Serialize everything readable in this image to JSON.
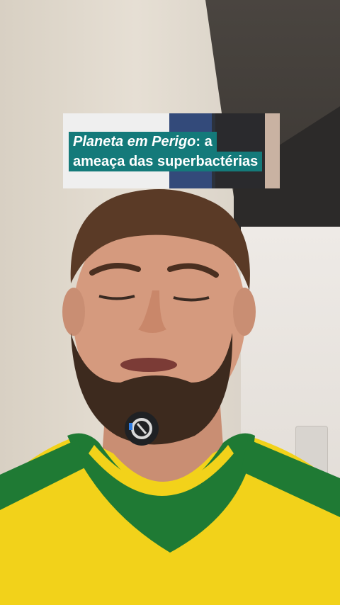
{
  "caption": {
    "line1_italic": "Planeta em Perigo",
    "line1_rest": ": a",
    "line2": "ameaça das superbactérias"
  },
  "colors": {
    "caption_background": "#147a7a",
    "caption_text": "#ffffff",
    "shirt_yellow": "#f2d21a",
    "shirt_green": "#1f7a34"
  },
  "icons": {
    "microphone": "lapel-microphone-icon"
  }
}
